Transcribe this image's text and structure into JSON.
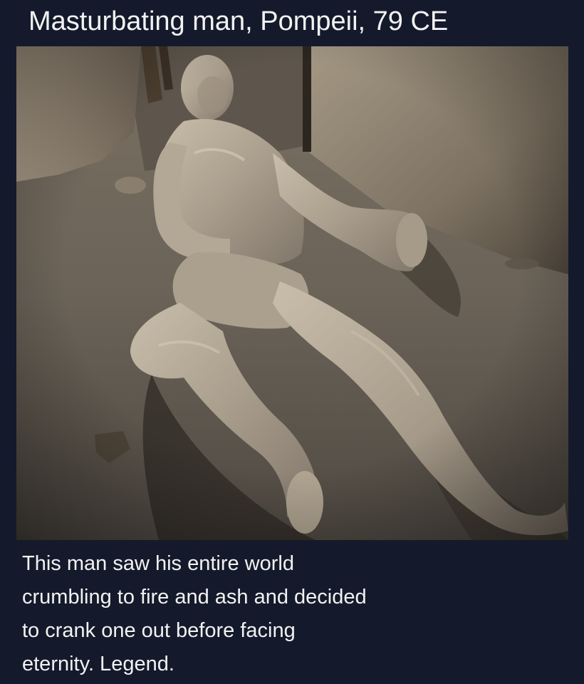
{
  "post": {
    "title": "Masturbating man, Pompeii, 79 CE",
    "caption_lines": [
      "This man saw his entire world",
      "crumbling to fire and ash and decided",
      "to crank one out before facing",
      "eternity. Legend."
    ]
  },
  "photo": {
    "icon": "plaster-cast-photo",
    "palette": {
      "floor": "#6e665c",
      "wall": "#8f8374",
      "shadow": "#2a241f",
      "cast": "#b8ac9c",
      "background": "#141a2b",
      "text": "#f2f2f2"
    }
  }
}
